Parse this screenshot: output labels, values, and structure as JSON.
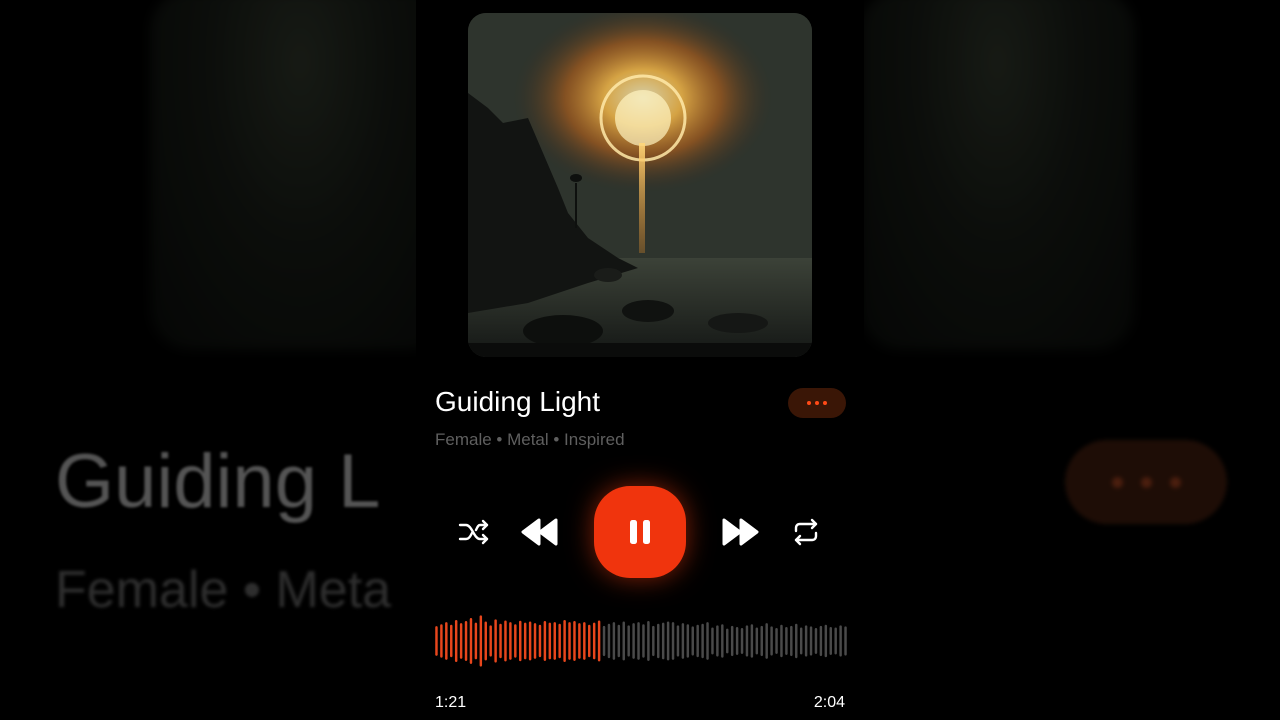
{
  "track": {
    "title": "Guiding Light",
    "tags": "Female • Metal • Inspired",
    "current_time": "1:21",
    "total_time": "2:04",
    "progress": 0.4
  },
  "background": {
    "title_fragment": "Guiding L",
    "tags_fragment": "Female • Meta"
  },
  "colors": {
    "accent": "#f0340d",
    "played_wave": "#e8461c",
    "unplayed_wave": "#4a4a4a",
    "tags_text": "#5f5f5f"
  },
  "icons": {
    "more": "more-horizontal-icon",
    "shuffle": "shuffle-icon",
    "rewind": "rewind-icon",
    "play_state": "pause-icon",
    "forward": "fast-forward-icon",
    "repeat": "repeat-icon"
  },
  "waveform": [
    0.55,
    0.62,
    0.7,
    0.6,
    0.78,
    0.66,
    0.74,
    0.85,
    0.68,
    0.95,
    0.72,
    0.58,
    0.8,
    0.64,
    0.76,
    0.7,
    0.62,
    0.75,
    0.68,
    0.72,
    0.66,
    0.6,
    0.74,
    0.68,
    0.7,
    0.64,
    0.78,
    0.7,
    0.74,
    0.66,
    0.7,
    0.6,
    0.68,
    0.76,
    0.56,
    0.64,
    0.7,
    0.6,
    0.72,
    0.58,
    0.66,
    0.7,
    0.62,
    0.74,
    0.56,
    0.64,
    0.68,
    0.72,
    0.7,
    0.58,
    0.66,
    0.62,
    0.54,
    0.6,
    0.64,
    0.7,
    0.5,
    0.58,
    0.62,
    0.46,
    0.56,
    0.52,
    0.48,
    0.58,
    0.62,
    0.5,
    0.56,
    0.66,
    0.54,
    0.48,
    0.6,
    0.52,
    0.56,
    0.64,
    0.5,
    0.58,
    0.54,
    0.48,
    0.56,
    0.6,
    0.52,
    0.5,
    0.58,
    0.54
  ]
}
